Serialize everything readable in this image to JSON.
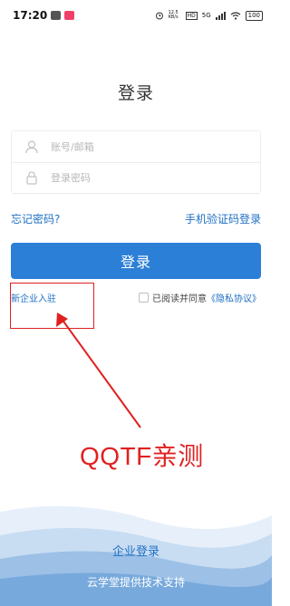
{
  "status_bar": {
    "time": "17:20",
    "network_speed": "12.5 KB/s",
    "signal": "5G",
    "battery": "100",
    "icons": [
      "alarm-icon",
      "hd-icon",
      "signal-icon",
      "wifi-icon",
      "battery-icon"
    ]
  },
  "page": {
    "title": "登录"
  },
  "form": {
    "account_placeholder": "账号/邮箱",
    "password_placeholder": "登录密码",
    "forgot_password": "忘记密码?",
    "sms_login": "手机验证码登录",
    "login_button": "登录",
    "register_link": "新企业入驻",
    "agree_text": "已阅读并同意",
    "privacy_link": "《隐私协议》"
  },
  "annotation": {
    "text": "QQTF亲测",
    "color": "#e02020"
  },
  "footer": {
    "enterprise_login": "企业登录",
    "support_text": "云学堂提供技术支持"
  },
  "colors": {
    "primary": "#2b7fd6",
    "link": "#1e6fc4",
    "annotation": "#e02020"
  }
}
